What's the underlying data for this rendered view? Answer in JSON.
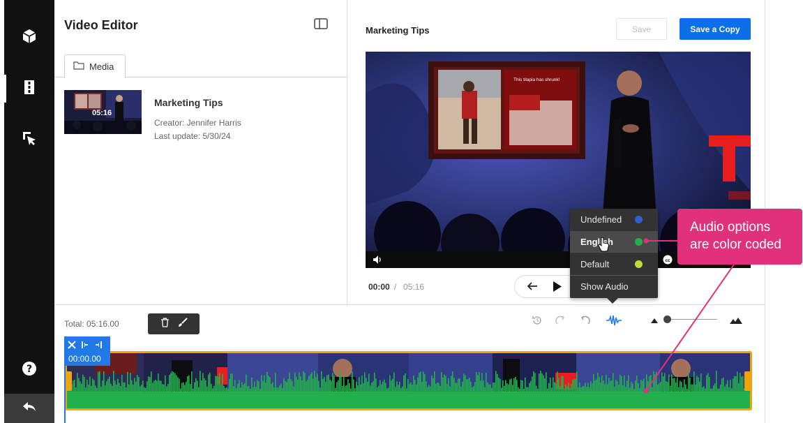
{
  "app": {
    "title": "Video Editor"
  },
  "left_panel": {
    "tab_label": "Media",
    "media_item": {
      "duration": "05:16",
      "title": "Marketing Tips",
      "creator": "Creator: Jennifer Harris",
      "last_update": "Last update: 5/30/24"
    }
  },
  "preview": {
    "title": "Marketing Tips",
    "save_label": "Save",
    "save_copy_label": "Save a Copy",
    "slide_caption": "This tilapia has shrunk!",
    "time_current": "00:00",
    "time_separator": "/",
    "time_total": "05:16"
  },
  "audio_menu": {
    "options": [
      {
        "label": "Undefined",
        "color": "#2f5fd0"
      },
      {
        "label": "English",
        "color": "#22b14c",
        "selected": true
      },
      {
        "label": "Default",
        "color": "#c5d934"
      }
    ],
    "show_audio_label": "Show Audio"
  },
  "callout": {
    "line1": "Audio options",
    "line2": "are color coded",
    "color": "#e0317a"
  },
  "timeline": {
    "total_label": "Total: 05:16.00",
    "trim_time": "00:00.00",
    "waveform_color": "#22b14c",
    "selection_color": "#f0a30a",
    "accent_color": "#1f7ae8"
  },
  "icons": [
    "cube-icon",
    "film-icon",
    "cursor-select-icon",
    "help-icon",
    "back-icon",
    "layout-toggle-icon",
    "folder-icon",
    "volume-icon",
    "cc-icon",
    "arrow-left-icon",
    "play-icon",
    "delete-icon",
    "brush-icon",
    "history-icon",
    "redo-icon",
    "undo-icon",
    "waveform-icon",
    "mountain-small-icon",
    "mountain-large-icon",
    "scissors-icon",
    "trim-start-icon",
    "trim-end-icon"
  ]
}
